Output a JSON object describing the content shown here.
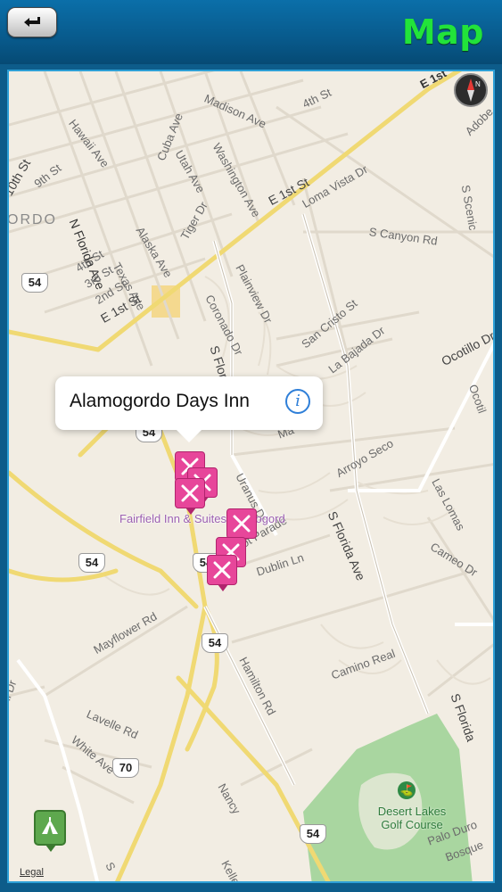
{
  "header": {
    "title": "Map",
    "back_icon": "back-arrow-icon"
  },
  "map": {
    "callout": {
      "title": "Alamogordo Days Inn",
      "info_icon": "info-icon"
    },
    "streets": {
      "hawaii_ave": "Hawaii Ave",
      "madison_ave": "Madison Ave",
      "fourth_st_top": "4th St",
      "e_1st_top": "E 1st",
      "adobe": "Adobe",
      "s_scenic": "S Scenic",
      "tenth_st": "10th St",
      "ninth_st": "9th St",
      "utah_ave": "Utah Ave",
      "cuba_ave": "Cuba Ave",
      "washington_ave": "Washington Ave",
      "e_1st_st": "E 1st St",
      "loma_vista": "Loma Vista Dr",
      "n_florida": "N Florida Ave",
      "alaska_ave": "Alaska Ave",
      "tiger_dr": "Tiger Dr",
      "s_canyon": "S Canyon Rd",
      "fourth_st": "4th St",
      "third_st": "3rd St",
      "texas_ave": "Texas Ave",
      "second_st": "2nd St",
      "plainview": "Plainview Dr",
      "coronado": "Coronado Dr",
      "e_1st_st_low": "E 1st St",
      "s_florida_mid": "S Florida",
      "san_cristo": "San Cristo St",
      "la_bajada": "La Bajada Dr",
      "ocotillo_dr": "Ocotillo Dr",
      "ocotillo": "Ocotil",
      "uranus": "Uranus Dr",
      "ma": "Ma",
      "arroyo_seco": "Arroyo Seco",
      "las_lomas": "Las Lomas",
      "s_florida_ave": "S Florida Ave",
      "cameo_dr": "Cameo Dr",
      "cot_parade": "cot Parade",
      "dublin_ln": "Dublin Ln",
      "mayflower": "Mayflower Rd",
      "hamilton": "Hamilton Rd",
      "camino_real": "Camino Real",
      "s_florida_low": "S Florida",
      "ini_dr": "ini Dr",
      "lavelle": "Lavelle Rd",
      "white_ave": "White Ave",
      "nancy": "Nancy",
      "palo_duro": "Palo Duro",
      "bosque": "Bosque",
      "kelle": "Kelle",
      "s": "S",
      "ordo": "ORDO"
    },
    "shields": [
      "54",
      "54",
      "54",
      "54",
      "54",
      "70",
      "54"
    ],
    "poi_label": "Fairfield Inn & Suites Alamogord",
    "golf_label": "Desert Lakes Golf Course",
    "legal": "Legal",
    "compass_icon": "compass-icon",
    "camp_icon": "tent-icon",
    "pin_icon": "restaurant-icon"
  }
}
